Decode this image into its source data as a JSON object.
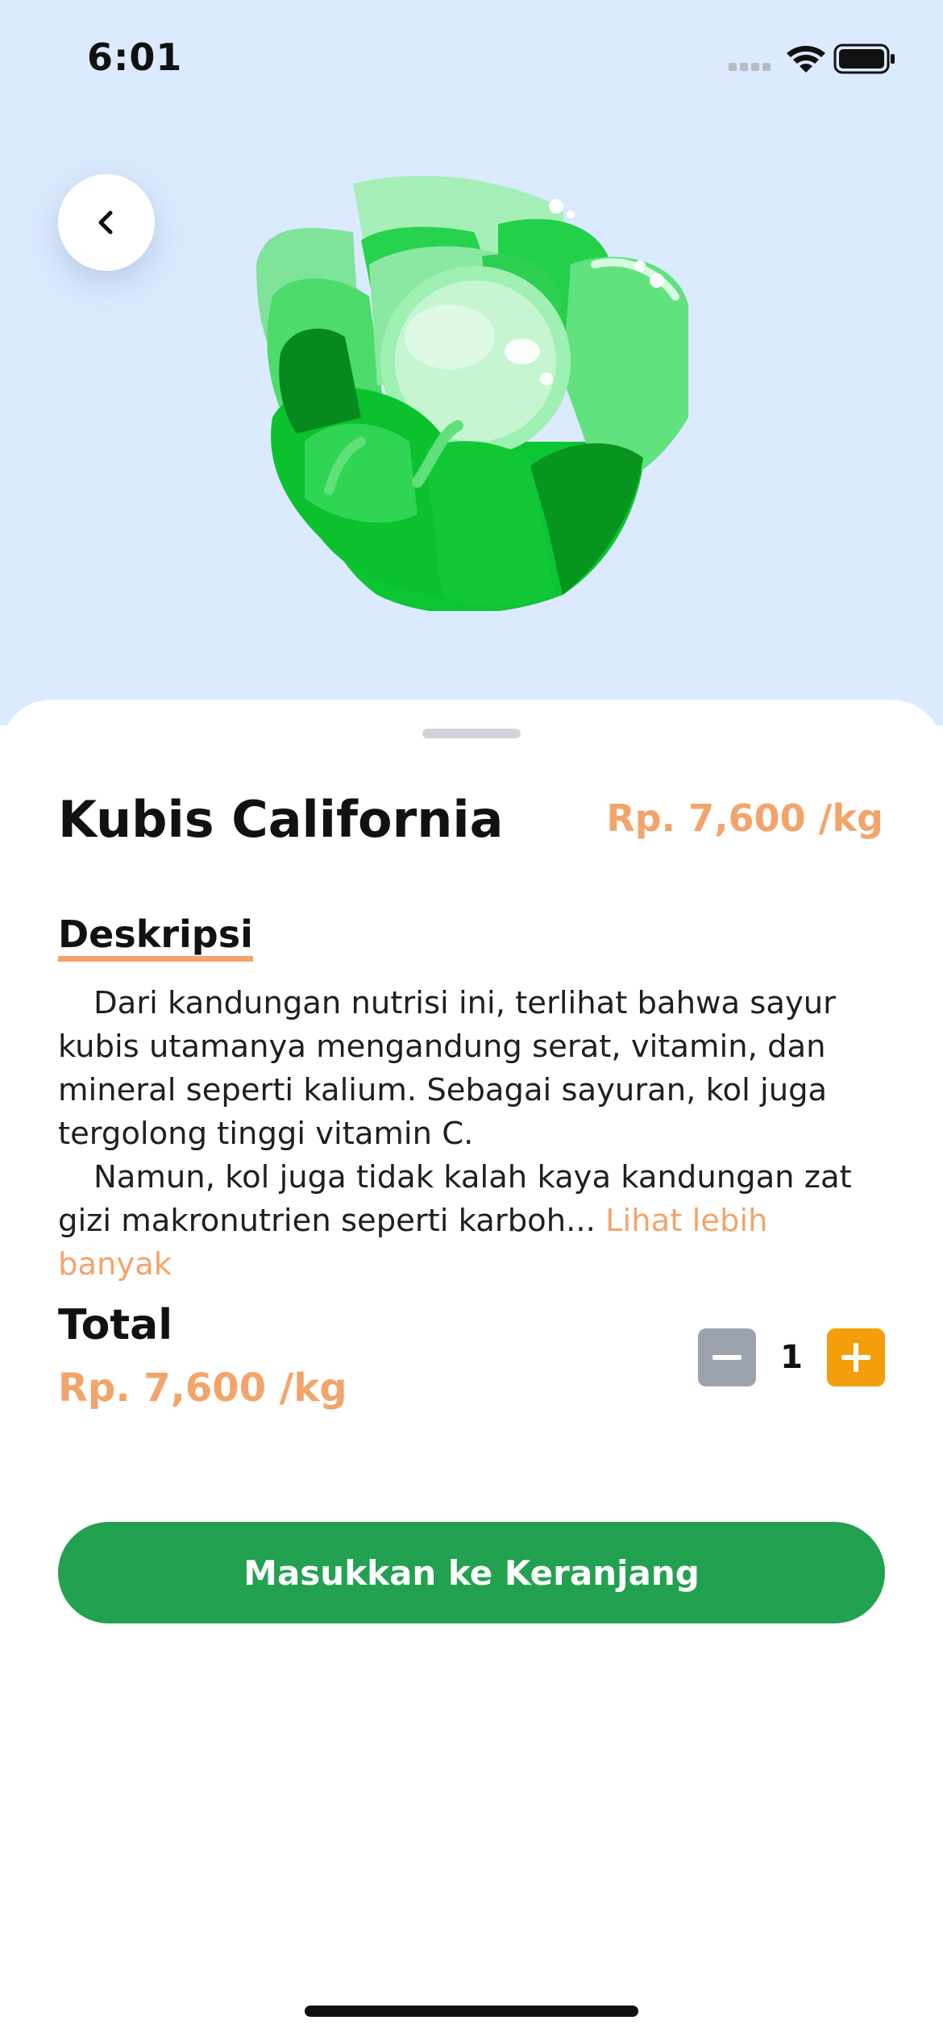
{
  "status_bar": {
    "time": "6:01",
    "icons": [
      "signal-dots-icon",
      "wifi-icon",
      "battery-icon"
    ]
  },
  "header": {
    "back_icon": "chevron-left-icon",
    "product_image": "cabbage-illustration"
  },
  "product": {
    "name": "Kubis California",
    "price": "Rp. 7,600 /kg"
  },
  "description": {
    "heading": "Deskripsi",
    "paragraph_1": "Dari kandungan nutrisi ini, terlihat bahwa sayur kubis utamanya mengandung serat, vitamin, dan mineral seperti kalium. Sebagai sayuran, kol juga tergolong tinggi vitamin C.",
    "paragraph_2": "Namun, kol juga tidak kalah kaya kandungan zat gizi makronutrien seperti karboh...",
    "see_more": "Lihat lebih banyak"
  },
  "total": {
    "label": "Total",
    "price": "Rp. 7,600 /kg",
    "quantity": "1",
    "minus_icon": "minus-icon",
    "plus_icon": "plus-icon"
  },
  "cta": {
    "label": "Masukkan ke Keranjang"
  },
  "colors": {
    "hero_bg": "#dbeafe",
    "accent_orange": "#f2a46b",
    "plus_orange": "#f59e0b",
    "minus_gray": "#9ca3af",
    "cta_green": "#22a150"
  }
}
